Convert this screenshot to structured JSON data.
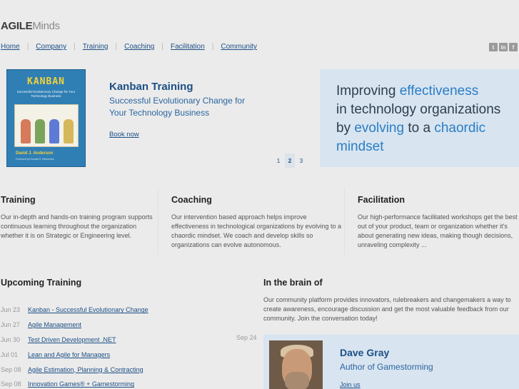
{
  "header": {
    "logo_bold": "AGILE",
    "logo_light": "Minds",
    "nav": [
      "Home",
      "Company",
      "Training",
      "Coaching",
      "Facilitation",
      "Community"
    ],
    "social": [
      {
        "icon": "twitter-icon",
        "glyph": "t"
      },
      {
        "icon": "linkedin-icon",
        "glyph": "in"
      },
      {
        "icon": "facebook-icon",
        "glyph": "f"
      }
    ]
  },
  "hero": {
    "book": {
      "title": "KANBAN",
      "subtitle": "Successful Evolutionary Change for Your Technology Business",
      "author": "David J. Anderson",
      "publisher": "Foreword by Donald G. Reinertsen"
    },
    "title": "Kanban Training",
    "subtitle": "Successful Evolutionary Change for Your Technology Business",
    "link": "Book now",
    "pager": [
      "1",
      "2",
      "3"
    ],
    "pager_active": "2"
  },
  "tagline": {
    "p1": "Improving ",
    "h1": "effectiveness",
    "p2": "in technology organizations",
    "p3": "by ",
    "h2": "evolving",
    "p4": " to a ",
    "h3": "chaordic",
    "h4": "mindset"
  },
  "columns": [
    {
      "title": "Training",
      "text": "Our in-depth and hands-on training program supports continuous learning throughout the organization whether it is on Strategic or Engineering level."
    },
    {
      "title": "Coaching",
      "text": "Our intervention based approach helps improve effectiveness in technological organizations by evolving to a chaordic mindset. We coach and develop skills so organizations can evolve autonomous."
    },
    {
      "title": "Facilitation",
      "text": "Our high-performance facilitated workshops get the best out of your product, team or organization whether it's about generating new ideas, making though decisions, unraveling complexity ..."
    }
  ],
  "upcoming": {
    "title": "Upcoming Training",
    "items": [
      {
        "date": "Jun 23",
        "label": "Kanban - Successful Evolutionary Change"
      },
      {
        "date": "Jun 27",
        "label": "Agile Management"
      },
      {
        "date": "Jun 30",
        "label": "Test Driven Development .NET"
      },
      {
        "date": "Jul 01",
        "label": "Lean and Agile for Managers"
      },
      {
        "date": "Sep 08",
        "label": "Agile Estimation, Planning & Contracting"
      },
      {
        "date": "Sep 08",
        "label": "Innovation Games® + Gamestorming"
      }
    ]
  },
  "brain": {
    "title": "In the brain of",
    "text": "Our community platform provides innovators, rulebreakers and changemakers a way to create awareness, encourage discussion and get the most valuable feedback from our community. Join the conversation today!",
    "date": "Sep 24",
    "name": "Dave Gray",
    "role": "Author of Gamestorming",
    "link": "Join us"
  },
  "colors": {
    "link": "#1c4f86",
    "accent": "#2a7ec5",
    "panel": "#d8e4f0",
    "background": "#ebebeb"
  }
}
